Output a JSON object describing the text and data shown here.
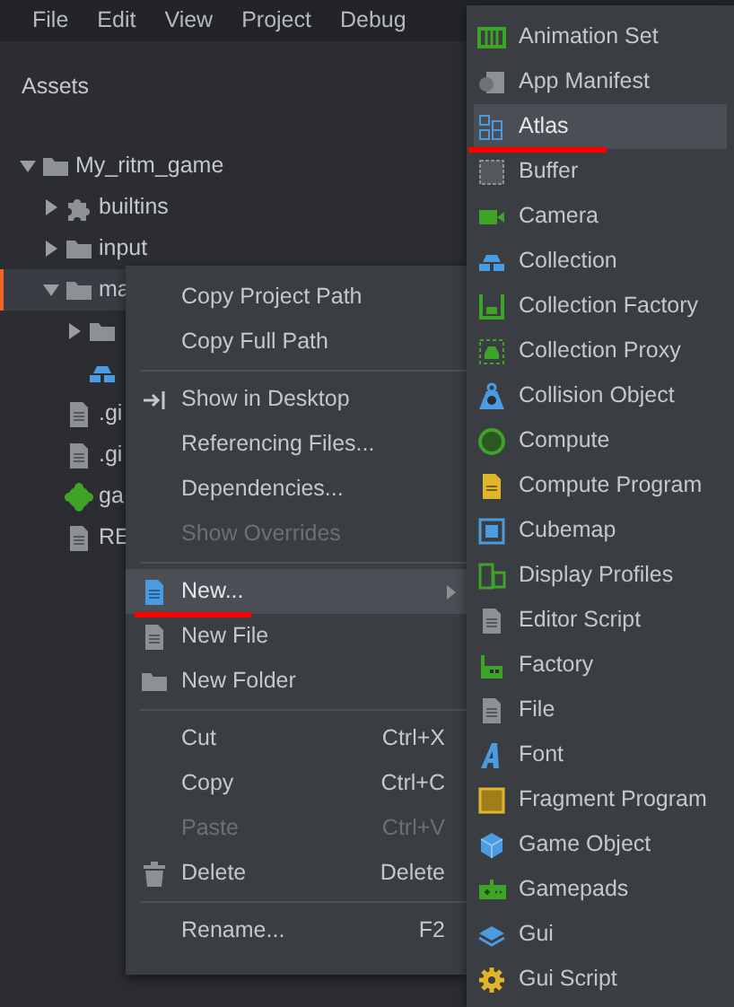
{
  "menubar": [
    "File",
    "Edit",
    "View",
    "Project",
    "Debug"
  ],
  "panel_title": "Assets",
  "tree": [
    {
      "label": "My_ritm_game",
      "kind": "folder",
      "expanded": true,
      "selected": false,
      "children": [
        {
          "label": "builtins",
          "kind": "puzzle",
          "expanded": false,
          "selected": false
        },
        {
          "label": "input",
          "kind": "folder",
          "expanded": false,
          "selected": false
        },
        {
          "label": "ma",
          "kind": "folder",
          "expanded": true,
          "selected": true,
          "children": [
            {
              "kind": "folder",
              "expanded": false,
              "selected": false
            },
            {
              "kind": "collection",
              "selected": false
            }
          ]
        },
        {
          "label": ".gi",
          "kind": "file",
          "selected": false
        },
        {
          "label": ".gi",
          "kind": "file",
          "selected": false
        },
        {
          "label": "ga",
          "kind": "cog",
          "selected": false
        },
        {
          "label": "RE",
          "kind": "file",
          "selected": false
        }
      ]
    }
  ],
  "context_menu": [
    {
      "kind": "item",
      "label": "Copy Project Path"
    },
    {
      "kind": "item",
      "label": "Copy Full Path"
    },
    {
      "kind": "separator"
    },
    {
      "kind": "item",
      "label": "Show in Desktop"
    },
    {
      "kind": "item",
      "label": "Referencing Files..."
    },
    {
      "kind": "item",
      "label": "Dependencies..."
    },
    {
      "kind": "item",
      "label": "Show Overrides",
      "disabled": true
    },
    {
      "kind": "separator"
    },
    {
      "kind": "item",
      "label": "New...",
      "highlighted": true,
      "submenu": true,
      "underlined": true
    },
    {
      "kind": "item",
      "label": "New File"
    },
    {
      "kind": "item",
      "label": "New Folder"
    },
    {
      "kind": "separator"
    },
    {
      "kind": "item",
      "label": "Cut",
      "shortcut": "Ctrl+X"
    },
    {
      "kind": "item",
      "label": "Copy",
      "shortcut": "Ctrl+C"
    },
    {
      "kind": "item",
      "label": "Paste",
      "shortcut": "Ctrl+V",
      "disabled": true
    },
    {
      "kind": "item",
      "label": "Delete",
      "shortcut": "Delete"
    },
    {
      "kind": "separator"
    },
    {
      "kind": "item",
      "label": "Rename...",
      "shortcut": "F2"
    }
  ],
  "new_submenu": [
    {
      "label": "Animation Set",
      "highlighted": false
    },
    {
      "label": "App Manifest",
      "highlighted": false
    },
    {
      "label": "Atlas",
      "highlighted": true,
      "underlined": true
    },
    {
      "label": "Buffer",
      "highlighted": false
    },
    {
      "label": "Camera",
      "highlighted": false
    },
    {
      "label": "Collection",
      "highlighted": false
    },
    {
      "label": "Collection Factory",
      "highlighted": false
    },
    {
      "label": "Collection Proxy",
      "highlighted": false
    },
    {
      "label": "Collision Object",
      "highlighted": false
    },
    {
      "label": "Compute",
      "highlighted": false
    },
    {
      "label": "Compute Program",
      "highlighted": false
    },
    {
      "label": "Cubemap",
      "highlighted": false
    },
    {
      "label": "Display Profiles",
      "highlighted": false
    },
    {
      "label": "Editor Script",
      "highlighted": false
    },
    {
      "label": "Factory",
      "highlighted": false
    },
    {
      "label": "File",
      "highlighted": false
    },
    {
      "label": "Font",
      "highlighted": false
    },
    {
      "label": "Fragment Program",
      "highlighted": false
    },
    {
      "label": "Game Object",
      "highlighted": false
    },
    {
      "label": "Gamepads",
      "highlighted": false
    },
    {
      "label": "Gui",
      "highlighted": false
    },
    {
      "label": "Gui Script",
      "highlighted": false
    }
  ]
}
